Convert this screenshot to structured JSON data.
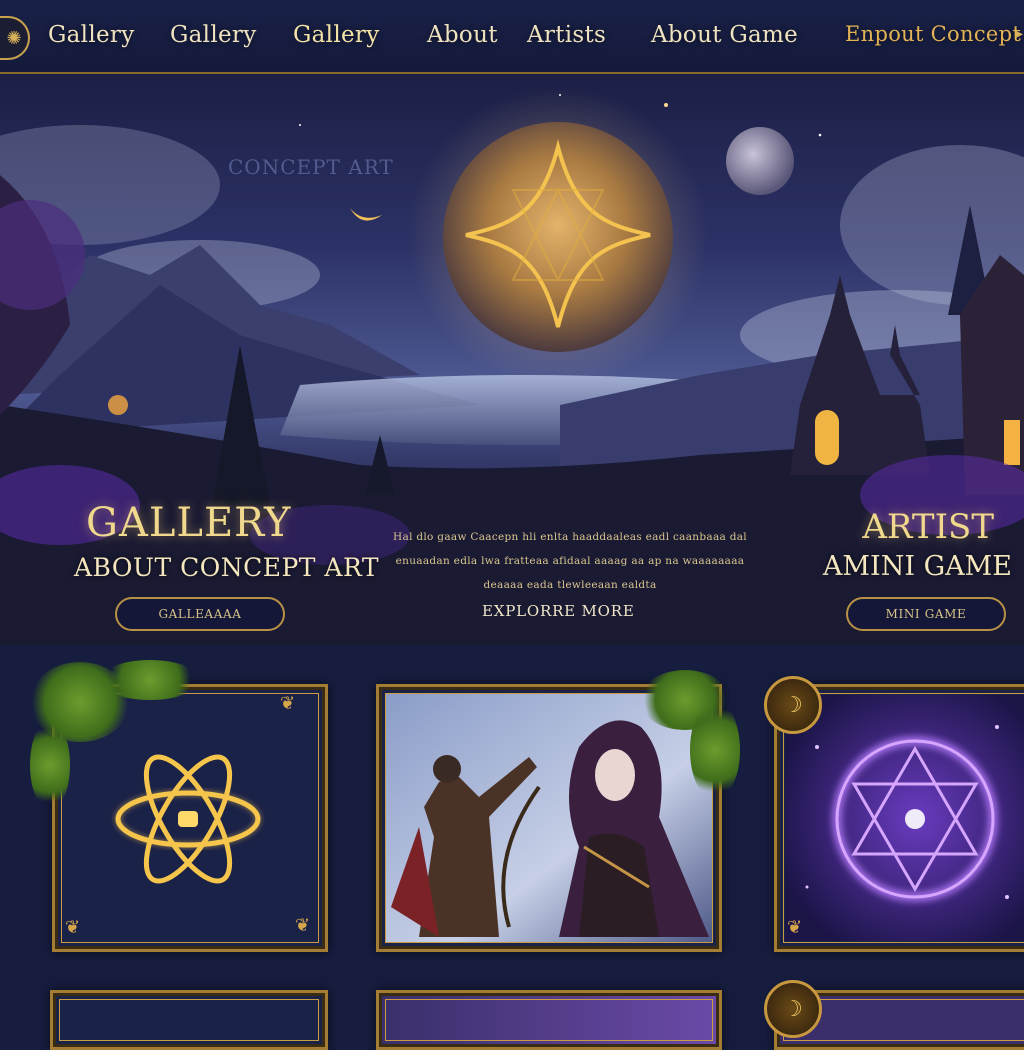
{
  "nav": {
    "items": [
      {
        "label": "Gallery"
      },
      {
        "label": "Gallery"
      },
      {
        "label": "Gallery"
      },
      {
        "label": "About"
      },
      {
        "label": "Artists"
      },
      {
        "label": "About Game"
      },
      {
        "label": "Enpout Concept"
      }
    ],
    "logo_icon": "rune-emblem-icon"
  },
  "hero": {
    "watermark": "CONCEPT ART",
    "left_title": "GALLERY",
    "left_subtitle": "ABOUT CONCEPT ART",
    "right_title": "ARTIST",
    "right_subtitle": "AMINI GAME",
    "description": "Hal dlo gaaw Caacepn hli enlta haaddaaleas eadl caanbaaa dal enuaadan edla lwa fratteaa afidaal aaaag aa ap na waaaaaaaa deaaaa eada tlewleeaan ealdta",
    "left_button": "GALLEAAAA",
    "explore": "EXPLORRE MORE",
    "right_button": "MINI GAME"
  },
  "colors": {
    "background": "#161d3e",
    "gold": "#c9a24e",
    "text_gold": "#f0d88c",
    "purple_glow": "#a35cff"
  },
  "cards": [
    {
      "subject": "golden-atom-rune"
    },
    {
      "subject": "hooded-archer-and-warrior"
    },
    {
      "subject": "purple-hexagram-sigil"
    }
  ]
}
